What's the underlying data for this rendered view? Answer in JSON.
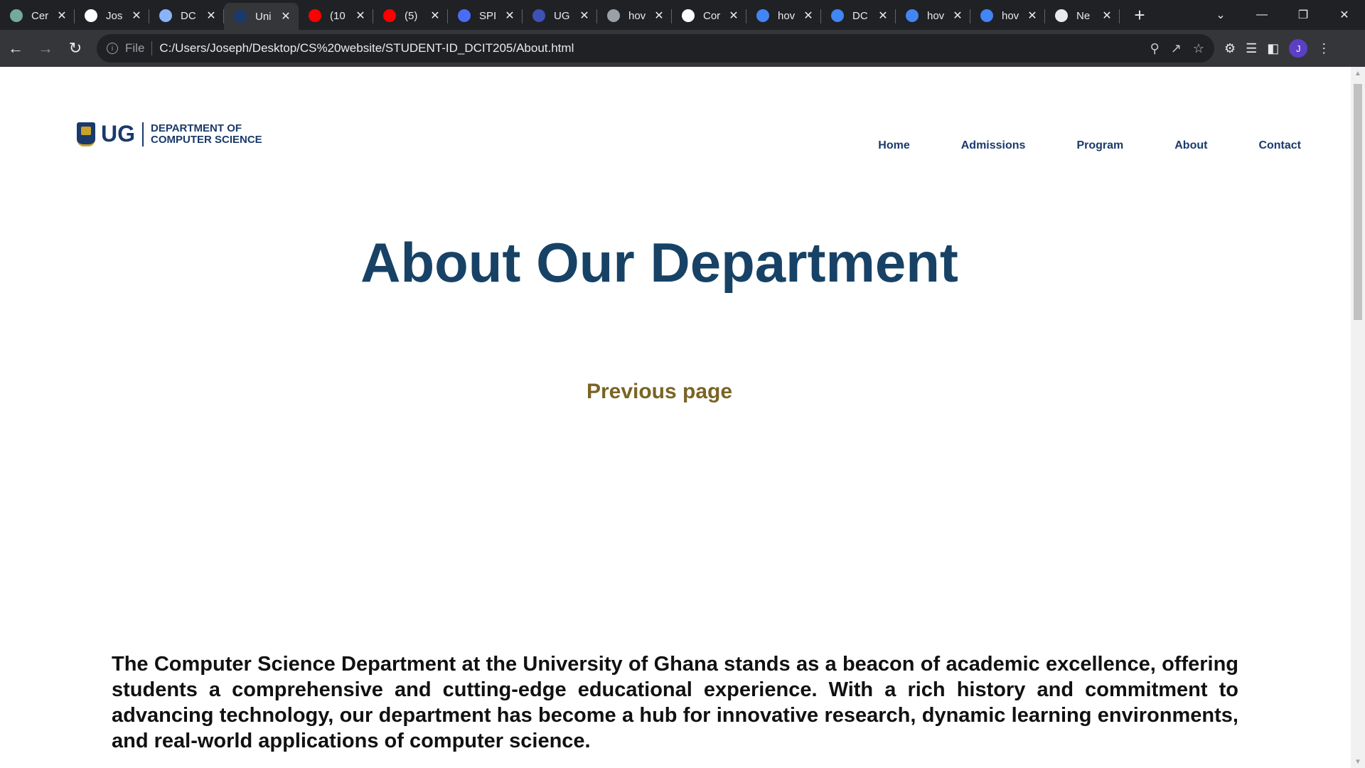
{
  "browser": {
    "tabs": [
      {
        "title": "Cer",
        "icon": "chatgpt-icon",
        "color": "#74aa9c",
        "active": false
      },
      {
        "title": "Jos",
        "icon": "github-icon",
        "color": "#ffffff",
        "active": false
      },
      {
        "title": "DC",
        "icon": "globe-icon",
        "color": "#8ab4f8",
        "active": false
      },
      {
        "title": "Uni",
        "icon": "ug-crest-icon",
        "color": "#1a3a6b",
        "active": true
      },
      {
        "title": "(10",
        "icon": "youtube-icon",
        "color": "#ff0000",
        "active": false
      },
      {
        "title": "(5)",
        "icon": "youtube-icon",
        "color": "#ff0000",
        "active": false
      },
      {
        "title": "SPI",
        "icon": "site-icon",
        "color": "#4a6cf7",
        "active": false
      },
      {
        "title": "UG",
        "icon": "site-icon",
        "color": "#3f51b5",
        "active": false
      },
      {
        "title": "hov",
        "icon": "chatgpt-icon",
        "color": "#9aa0a6",
        "active": false
      },
      {
        "title": "Cor",
        "icon": "github-icon",
        "color": "#ffffff",
        "active": false
      },
      {
        "title": "hov",
        "icon": "google-icon",
        "color": "#4285f4",
        "active": false
      },
      {
        "title": "DC",
        "icon": "docs-icon",
        "color": "#4285f4",
        "active": false
      },
      {
        "title": "hov",
        "icon": "google-icon",
        "color": "#4285f4",
        "active": false
      },
      {
        "title": "hov",
        "icon": "google-icon",
        "color": "#4285f4",
        "active": false
      },
      {
        "title": "Ne",
        "icon": "chrome-icon",
        "color": "#e8eaed",
        "active": false
      }
    ],
    "new_tab_label": "+",
    "omnibox": {
      "scheme": "File",
      "url": "C:/Users/Joseph/Desktop/CS%20website/STUDENT-ID_DCIT205/About.html"
    },
    "profile_initial": "J"
  },
  "site": {
    "logo": {
      "mark": "UG",
      "line1": "DEPARTMENT OF",
      "line2": "COMPUTER SCIENCE"
    },
    "nav": {
      "home": "Home",
      "admissions": "Admissions",
      "program": "Program",
      "about": "About",
      "contact": "Contact"
    },
    "title": "About Our Department",
    "previous_link": "Previous page",
    "intro": "The Computer Science Department at the University of Ghana stands as a beacon of academic excellence, offering students a comprehensive and cutting-edge educational experience. With a rich history and commitment to advancing technology, our department has become a hub for innovative research, dynamic learning environments, and real-world applications of computer science."
  }
}
